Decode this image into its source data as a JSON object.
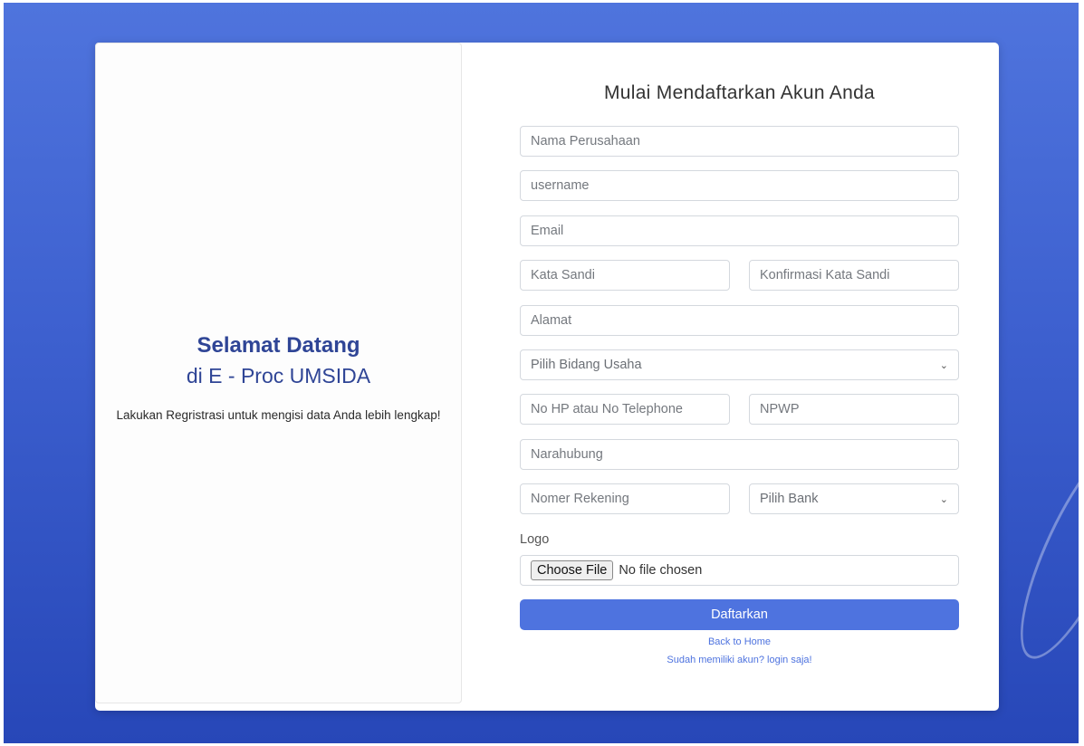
{
  "welcome": {
    "heading": "Selamat Datang",
    "subheading": "di E - Proc UMSIDA",
    "note": "Lakukan Regristrasi untuk mengisi data Anda lebih lengkap!"
  },
  "form": {
    "title": "Mulai Mendaftarkan Akun Anda",
    "company_placeholder": "Nama Perusahaan",
    "username_placeholder": "username",
    "email_placeholder": "Email",
    "password_placeholder": "Kata Sandi",
    "confirm_password_placeholder": "Konfirmasi Kata Sandi",
    "address_placeholder": "Alamat",
    "business_field_selected": "Pilih Bidang Usaha",
    "phone_placeholder": "No HP atau No Telephone",
    "npwp_placeholder": "NPWP",
    "contact_placeholder": "Narahubung",
    "account_number_placeholder": "Nomer Rekening",
    "bank_selected": "Pilih Bank",
    "logo_label": "Logo",
    "choose_file_label": "Choose File",
    "file_status": "No file chosen",
    "submit_label": "Daftarkan",
    "back_home_link": "Back to Home",
    "login_link": "Sudah memiliki akun? login saja!"
  },
  "icons": {
    "select_arrow": "chevron-down-icon"
  },
  "colors": {
    "background": "#3d60cf",
    "primary": "#4e73df",
    "heading": "#2f4596"
  }
}
